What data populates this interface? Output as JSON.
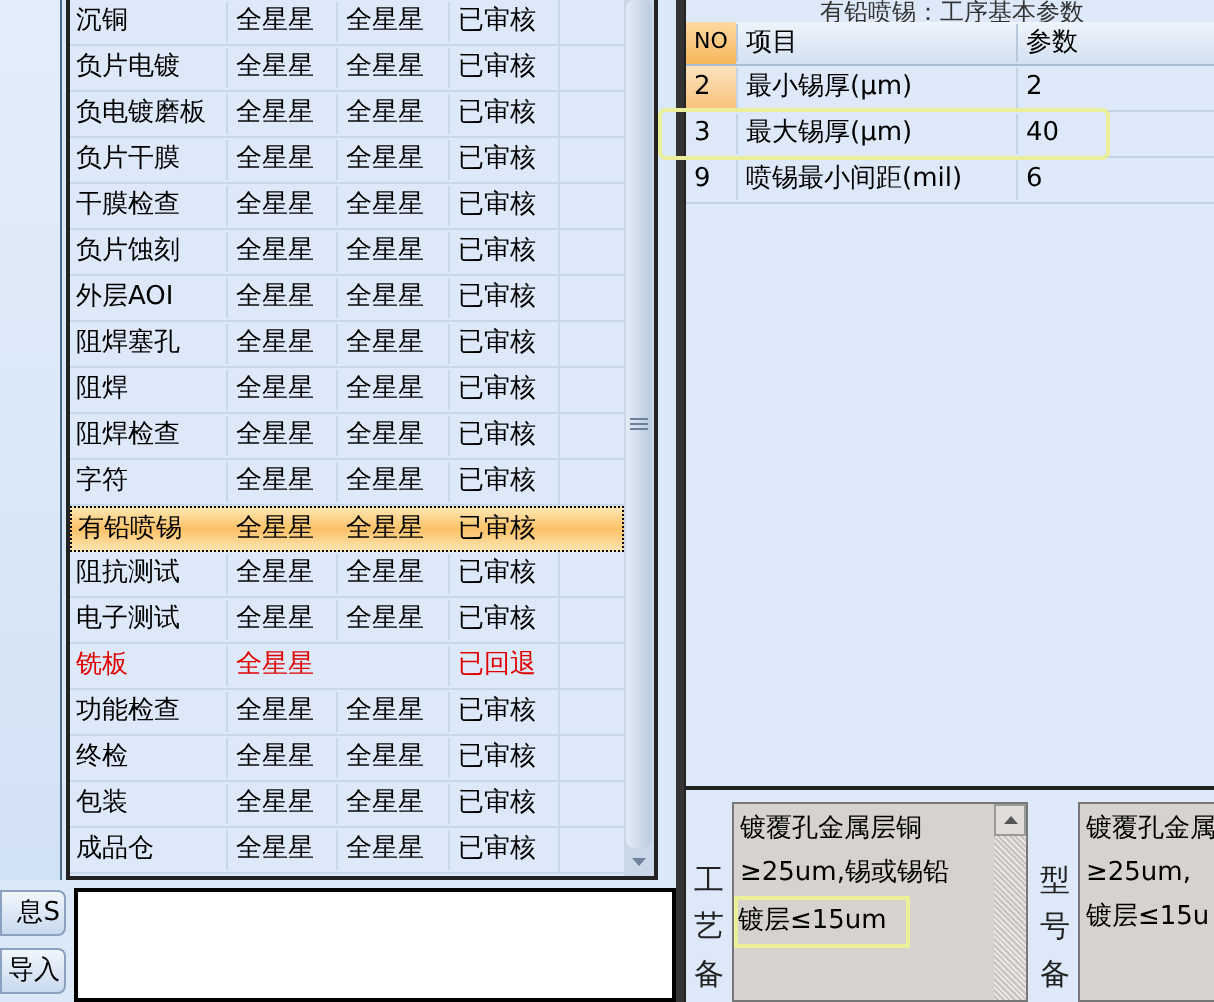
{
  "process_grid": {
    "rows": [
      {
        "name": "沉铜",
        "col_2": "全星星",
        "col_3": "全星星",
        "status": "已审核",
        "kind": "normal",
        "selected": false
      },
      {
        "name": "负片电镀",
        "col_2": "全星星",
        "col_3": "全星星",
        "status": "已审核",
        "kind": "normal",
        "selected": false
      },
      {
        "name": "负电镀磨板",
        "col_2": "全星星",
        "col_3": "全星星",
        "status": "已审核",
        "kind": "normal",
        "selected": false
      },
      {
        "name": "负片干膜",
        "col_2": "全星星",
        "col_3": "全星星",
        "status": "已审核",
        "kind": "normal",
        "selected": false
      },
      {
        "name": "干膜检查",
        "col_2": "全星星",
        "col_3": "全星星",
        "status": "已审核",
        "kind": "normal",
        "selected": false
      },
      {
        "name": "负片蚀刻",
        "col_2": "全星星",
        "col_3": "全星星",
        "status": "已审核",
        "kind": "normal",
        "selected": false
      },
      {
        "name": "外层AOI",
        "col_2": "全星星",
        "col_3": "全星星",
        "status": "已审核",
        "kind": "normal",
        "selected": false
      },
      {
        "name": "阻焊塞孔",
        "col_2": "全星星",
        "col_3": "全星星",
        "status": "已审核",
        "kind": "normal",
        "selected": false
      },
      {
        "name": "阻焊",
        "col_2": "全星星",
        "col_3": "全星星",
        "status": "已审核",
        "kind": "normal",
        "selected": false
      },
      {
        "name": "阻焊检查",
        "col_2": "全星星",
        "col_3": "全星星",
        "status": "已审核",
        "kind": "normal",
        "selected": false
      },
      {
        "name": "字符",
        "col_2": "全星星",
        "col_3": "全星星",
        "status": "已审核",
        "kind": "normal",
        "selected": false
      },
      {
        "name": "有铅喷锡",
        "col_2": "全星星",
        "col_3": "全星星",
        "status": "已审核",
        "kind": "normal",
        "selected": true
      },
      {
        "name": "阻抗测试",
        "col_2": "全星星",
        "col_3": "全星星",
        "status": "已审核",
        "kind": "normal",
        "selected": false
      },
      {
        "name": "电子测试",
        "col_2": "全星星",
        "col_3": "全星星",
        "status": "已审核",
        "kind": "normal",
        "selected": false
      },
      {
        "name": "铣板",
        "col_2": "全星星",
        "status": "已回退",
        "kind": "returned",
        "selected": false
      },
      {
        "name": "功能检查",
        "col_2": "全星星",
        "col_3": "全星星",
        "status": "已审核",
        "kind": "normal",
        "selected": false
      },
      {
        "name": "终检",
        "col_2": "全星星",
        "col_3": "全星星",
        "status": "已审核",
        "kind": "normal",
        "selected": false
      },
      {
        "name": "包装",
        "col_2": "全星星",
        "col_3": "全星星",
        "status": "已审核",
        "kind": "normal",
        "selected": false
      },
      {
        "name": "成品仓",
        "col_2": "全星星",
        "col_3": "全星星",
        "status": "已审核",
        "kind": "normal",
        "selected": false
      }
    ]
  },
  "side_buttons": [
    "息S",
    "导入"
  ],
  "params": {
    "title": "有铅喷锡：工序基本参数",
    "columns": [
      "NO",
      "项目",
      "参数"
    ],
    "rows": [
      {
        "no": "2",
        "item": "最小锡厚(μm)",
        "value": "2",
        "highlighted": false
      },
      {
        "no": "3",
        "item": "最大锡厚(μm)",
        "value": "40",
        "highlighted": true
      },
      {
        "no": "9",
        "item": "喷锡最小间距(mil)",
        "value": "6",
        "highlighted": false
      }
    ]
  },
  "remarks": [
    {
      "label": "工艺备",
      "lines": [
        {
          "text": "镀覆孔金属层铜",
          "highlighted": false
        },
        {
          "text": "≥25um,锡或锡铅",
          "highlighted": false
        },
        {
          "text": "镀层≤15um",
          "highlighted": true
        }
      ],
      "scrollbar": true
    },
    {
      "label": "型号备",
      "lines": [
        {
          "text": "镀覆孔金属",
          "highlighted": false
        },
        {
          "text": "≥25um,",
          "highlighted": false
        },
        {
          "text": "镀层≤15u",
          "highlighted": false
        }
      ],
      "scrollbar": false
    }
  ]
}
